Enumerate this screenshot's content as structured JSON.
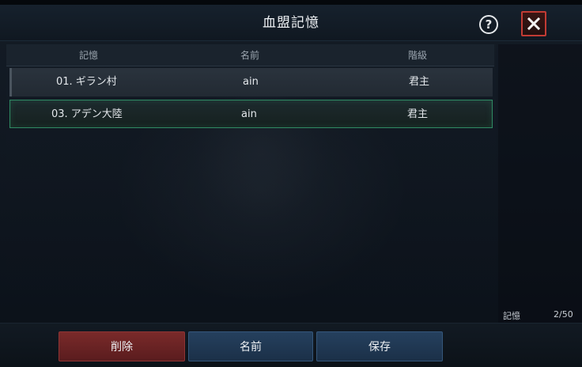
{
  "window": {
    "title": "血盟記憶"
  },
  "table": {
    "columns": [
      "記憶",
      "名前",
      "階級"
    ],
    "rows": [
      {
        "memory": "01. ギラン村",
        "name": "ain",
        "rank": "君主",
        "selected": false
      },
      {
        "memory": "03. アデン大陸",
        "name": "ain",
        "rank": "君主",
        "selected": true
      }
    ]
  },
  "status": {
    "memory_label": "記憶",
    "memory_count": "2/50"
  },
  "buttons": {
    "delete": "削除",
    "rename": "名前",
    "save": "保存",
    "help": "?"
  },
  "colors": {
    "selected_border": "#2f8a63",
    "close_border": "#c23b34",
    "delete_button": "#7a2a2a",
    "action_button": "#25405e"
  },
  "icons": {
    "help": "question-circle-icon",
    "close": "close-icon"
  }
}
